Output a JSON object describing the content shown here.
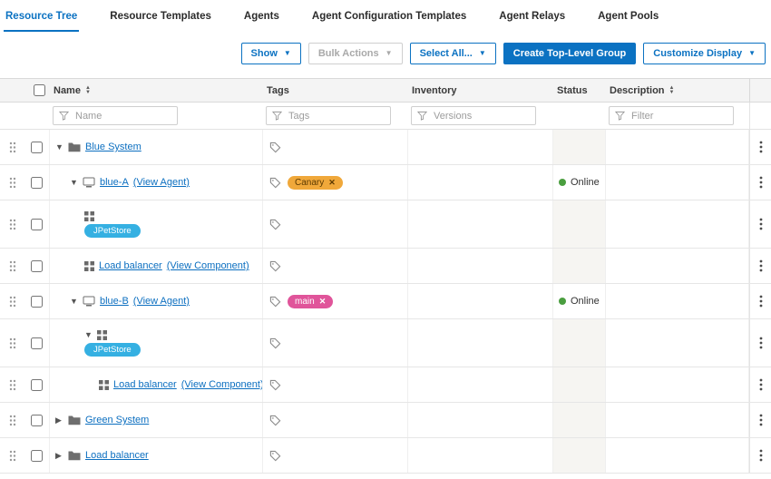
{
  "colors": {
    "accent": "#0b72c2",
    "link": "#0c6fc0",
    "online_green": "#4a9e3f",
    "component_pill_blue": "#35b0e2",
    "tag_canary_orange": "#f0a83a",
    "tag_main_pink": "#e0549a"
  },
  "tabs": [
    {
      "label": "Resource Tree",
      "active": true
    },
    {
      "label": "Resource Templates",
      "active": false
    },
    {
      "label": "Agents",
      "active": false
    },
    {
      "label": "Agent Configuration Templates",
      "active": false
    },
    {
      "label": "Agent Relays",
      "active": false
    },
    {
      "label": "Agent Pools",
      "active": false
    }
  ],
  "toolbar": {
    "show_label": "Show",
    "bulk_actions_label": "Bulk Actions",
    "select_all_label": "Select All...",
    "create_group_label": "Create Top-Level Group",
    "customize_label": "Customize Display"
  },
  "table": {
    "columns": [
      "Name",
      "Tags",
      "Inventory",
      "Status",
      "Description"
    ],
    "filter_placeholders": {
      "name": "Name",
      "tags": "Tags",
      "inventory": "Versions",
      "description": "Filter"
    }
  },
  "rows": [
    {
      "name": "Blue System",
      "type": "group",
      "expanded": true
    },
    {
      "name": "blue-A",
      "view_link": "(View Agent)",
      "type": "agent",
      "expanded": true,
      "tag": "Canary",
      "status": "Online"
    },
    {
      "pill": "JPetStore",
      "type": "component"
    },
    {
      "name": "Load balancer",
      "view_link": "(View Component)",
      "type": "component"
    },
    {
      "name": "blue-B",
      "view_link": "(View Agent)",
      "type": "agent",
      "expanded": true,
      "tag": "main",
      "status": "Online"
    },
    {
      "pill": "JPetStore",
      "type": "component",
      "expanded": true
    },
    {
      "name": "Load balancer",
      "view_link": "(View Component)",
      "type": "component"
    },
    {
      "name": "Green System",
      "type": "group",
      "expanded": false
    },
    {
      "name": "Load balancer",
      "type": "group",
      "expanded": false
    }
  ]
}
